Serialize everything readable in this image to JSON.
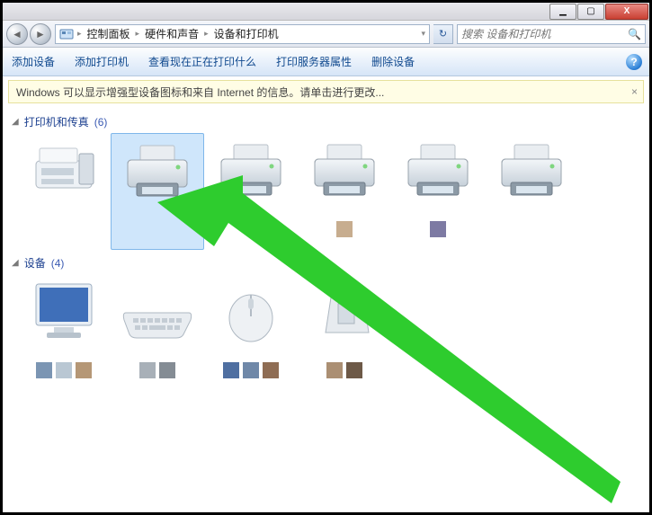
{
  "titlebar": {
    "minimize": "▁",
    "maximize": "▢",
    "close": "X"
  },
  "nav": {
    "back": "◄",
    "forward": "►"
  },
  "breadcrumb": {
    "root_icon": "🖥",
    "items": [
      "控制面板",
      "硬件和声音",
      "设备和打印机"
    ],
    "refresh": "↻"
  },
  "search": {
    "placeholder": "搜索 设备和打印机",
    "icon": "🔍"
  },
  "toolbar": {
    "add_device": "添加设备",
    "add_printer": "添加打印机",
    "see_printing": "查看现在正在打印什么",
    "server_props": "打印服务器属性",
    "remove_device": "删除设备",
    "help": "?"
  },
  "infobar": {
    "text": "Windows 可以显示增强型设备图标和来自 Internet 的信息。请单击进行更改...",
    "close": "×"
  },
  "groups": {
    "printers": {
      "label": "打印机和传真",
      "count": "(6)",
      "items": [
        {
          "name": "",
          "kind": "fax",
          "selected": false,
          "swatches": []
        },
        {
          "name": "",
          "kind": "printer",
          "selected": true,
          "default": false,
          "swatches": []
        },
        {
          "name": "",
          "kind": "printer",
          "selected": false,
          "default": true,
          "swatches": []
        },
        {
          "name": "",
          "kind": "printer",
          "selected": false,
          "default": false,
          "swatches": [
            "#c7ad8f"
          ]
        },
        {
          "name": "",
          "kind": "printer",
          "selected": false,
          "default": false,
          "swatches": [
            "#7d7aa3"
          ]
        },
        {
          "name": "",
          "kind": "printer",
          "selected": false,
          "default": false,
          "swatches": []
        }
      ]
    },
    "devices": {
      "label": "设备",
      "count": "(4)",
      "items": [
        {
          "name": "",
          "kind": "monitor",
          "swatches": [
            "#7b95b3",
            "#b9c7d3",
            "#b59776"
          ]
        },
        {
          "name": "",
          "kind": "keyboard",
          "swatches": [
            "#a8b0b8",
            "#848c94"
          ]
        },
        {
          "name": "",
          "kind": "mouse",
          "swatches": [
            "#4f6fa1",
            "#6f88a8",
            "#8f6d54"
          ]
        },
        {
          "name": "",
          "kind": "drive",
          "swatches": [
            "#ab8f73",
            "#6d5947"
          ]
        }
      ]
    }
  },
  "annotation": {
    "arrow_color": "#2ecc2e"
  }
}
